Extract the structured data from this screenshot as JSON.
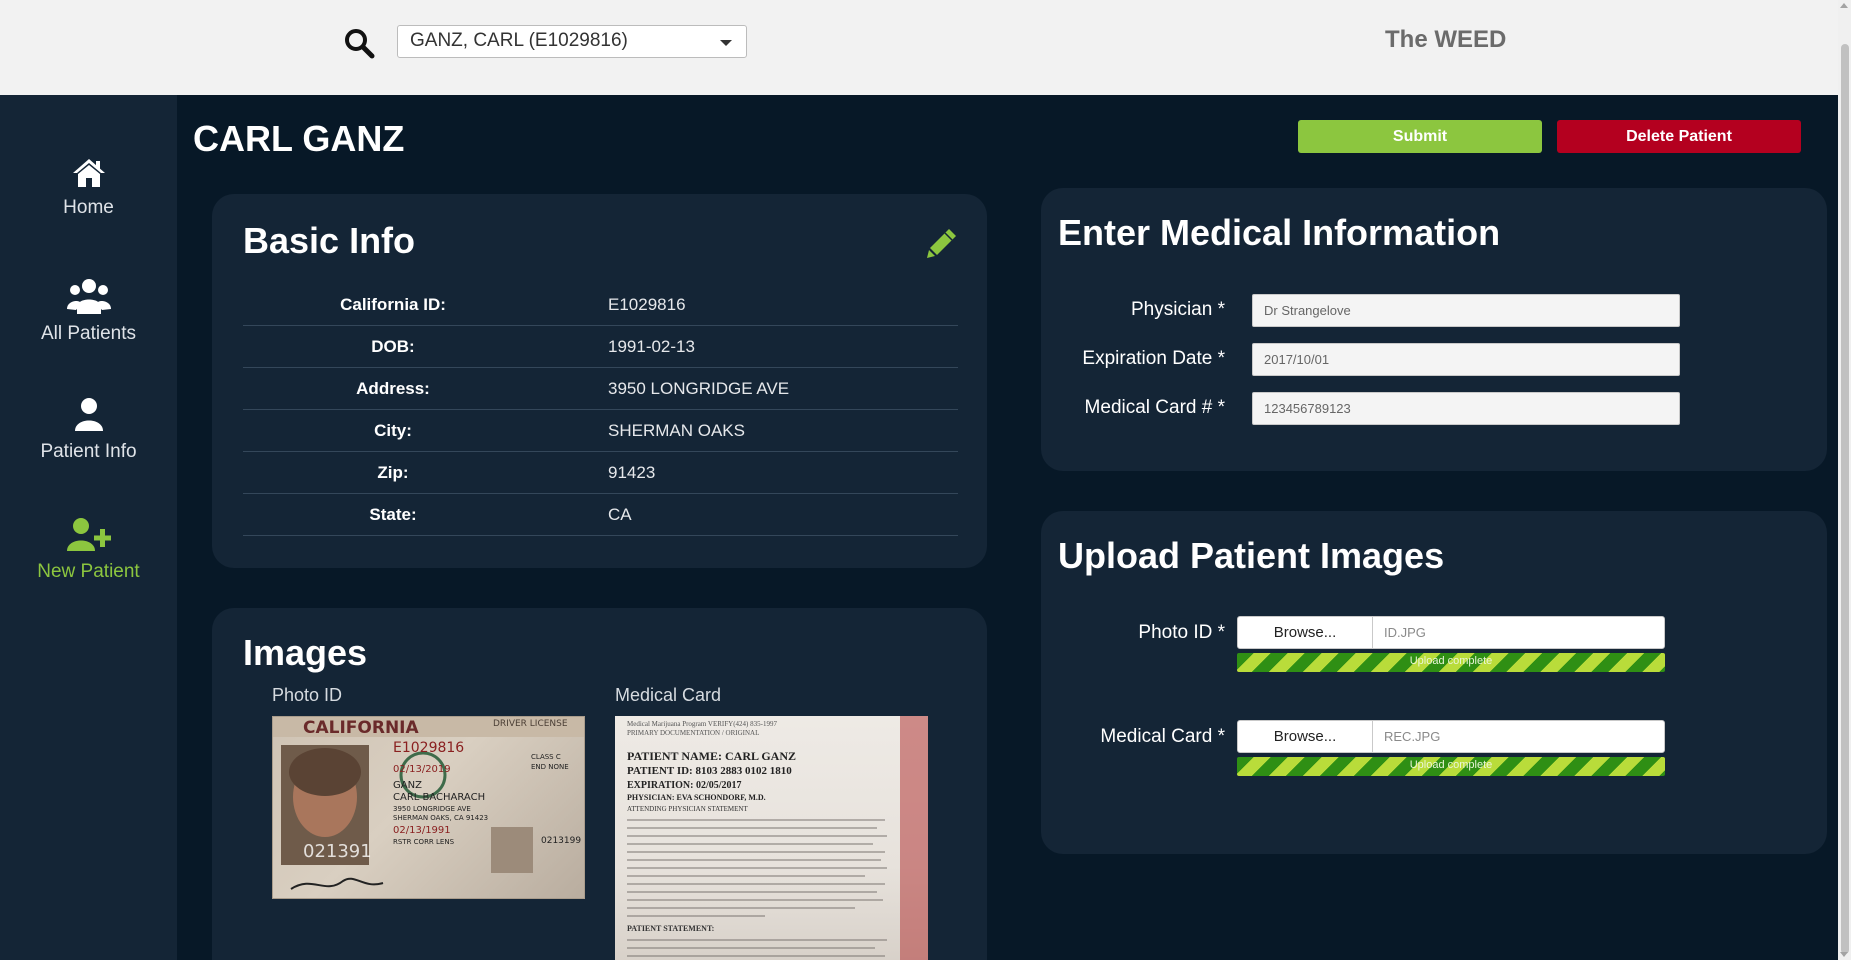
{
  "header": {
    "patient_select": "GANZ, CARL (E1029816)",
    "brand": "The WEED"
  },
  "sidebar": {
    "items": [
      {
        "label": "Home",
        "icon": "home-icon"
      },
      {
        "label": "All Patients",
        "icon": "users-icon"
      },
      {
        "label": "Patient Info",
        "icon": "user-icon"
      },
      {
        "label": "New Patient",
        "icon": "user-plus-icon"
      }
    ]
  },
  "main": {
    "title": "CARL GANZ",
    "submit_label": "Submit",
    "delete_label": "Delete Patient"
  },
  "basic_info": {
    "title": "Basic Info",
    "rows": [
      {
        "label": "California ID:",
        "value": "E1029816"
      },
      {
        "label": "DOB:",
        "value": "1991-02-13"
      },
      {
        "label": "Address:",
        "value": "3950 LONGRIDGE AVE"
      },
      {
        "label": "City:",
        "value": "SHERMAN OAKS"
      },
      {
        "label": "Zip:",
        "value": "91423"
      },
      {
        "label": "State:",
        "value": "CA"
      }
    ]
  },
  "images": {
    "title": "Images",
    "photo_id_label": "Photo ID",
    "medical_card_label": "Medical Card",
    "id_card_text": {
      "state": "CALIFORNIA",
      "type": "DRIVER LICENSE",
      "number": "E1029816",
      "exp": "02/13/2019",
      "name1": "GANZ",
      "name2": "CARL BACHARACH",
      "addr1": "3950 LONGRIDGE AVE",
      "addr2": "SHERMAN OAKS, CA 91423",
      "dob": "02/13/1991",
      "class": "CLASS C",
      "end": "END NONE",
      "rstr": "RSTR CORR LENS",
      "side_num": "0213199",
      "big_num": "021391"
    },
    "med_card_text": {
      "header": "Medical Marijuana Program VERIFY(424) 835-1997",
      "sub": "PRIMARY DOCUMENTATION / ORIGINAL",
      "name": "PATIENT NAME: CARL GANZ",
      "pid": "PATIENT ID: 8103 2883 0102 1810",
      "exp": "EXPIRATION: 02/05/2017",
      "phys": "PHYSICIAN: EVA SCHONDORF, M.D.",
      "attending": "ATTENDING PHYSICIAN STATEMENT",
      "statement": "PATIENT STATEMENT:"
    }
  },
  "medical_info": {
    "title": "Enter Medical Information",
    "fields": [
      {
        "label": "Physician *",
        "value": "Dr Strangelove"
      },
      {
        "label": "Expiration Date *",
        "value": "2017/10/01"
      },
      {
        "label": "Medical Card # *",
        "value": "123456789123"
      }
    ]
  },
  "uploads": {
    "title": "Upload Patient Images",
    "browse_label": "Browse...",
    "items": [
      {
        "label": "Photo ID *",
        "file": "ID.JPG",
        "status": "Upload complete",
        "progress": 1.0
      },
      {
        "label": "Medical Card *",
        "file": "REC.JPG",
        "status": "Upload complete",
        "progress": 1.0
      }
    ]
  },
  "colors": {
    "accent": "#8cc63f",
    "danger": "#b4001f",
    "background": "#071827",
    "panel": "#142536"
  }
}
